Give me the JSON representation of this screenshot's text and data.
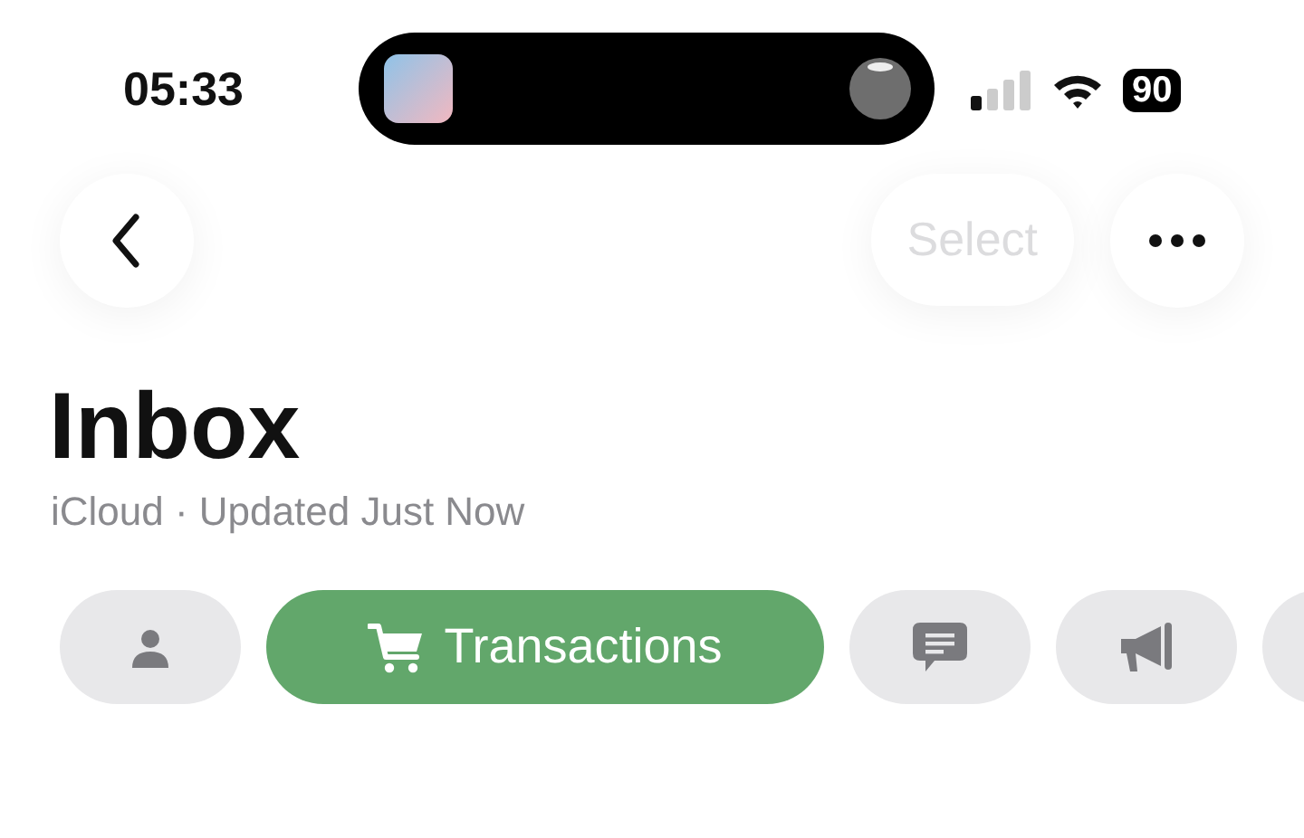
{
  "status_bar": {
    "time": "05:33",
    "battery": "90"
  },
  "nav": {
    "select": {
      "label": "Select",
      "disabled": true
    }
  },
  "header": {
    "title": "Inbox",
    "subtitle": "iCloud · Updated Just Now"
  },
  "categories": [
    {
      "kind": "person",
      "selected": false
    },
    {
      "kind": "cart",
      "label": "Transactions",
      "selected": true
    },
    {
      "kind": "chat",
      "selected": false
    },
    {
      "kind": "megaphone",
      "selected": false
    },
    {
      "kind": "partial",
      "selected": false
    }
  ]
}
